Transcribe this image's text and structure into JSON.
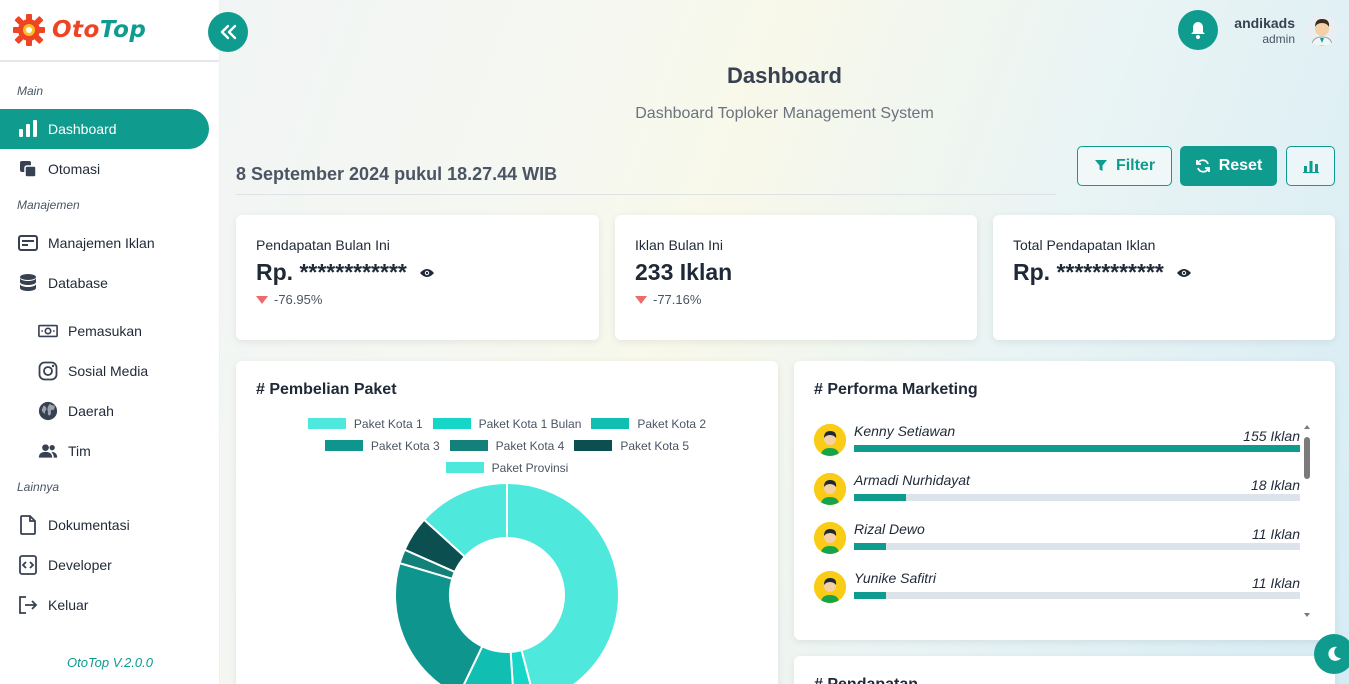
{
  "app": {
    "logo_text_a": "Oto",
    "logo_text_b": "Top",
    "version": "OtoTop V.2.0.0"
  },
  "sidebar": {
    "sections": {
      "main": "Main",
      "manajemen": "Manajemen",
      "lainnya": "Lainnya"
    },
    "items": {
      "dashboard": "Dashboard",
      "otomasi": "Otomasi",
      "manajemen_iklan": "Manajemen Iklan",
      "database": "Database",
      "pemasukan": "Pemasukan",
      "sosial_media": "Sosial Media",
      "daerah": "Daerah",
      "tim": "Tim",
      "dokumentasi": "Dokumentasi",
      "developer": "Developer",
      "keluar": "Keluar"
    }
  },
  "user": {
    "name": "andikads",
    "role": "admin"
  },
  "header": {
    "title": "Dashboard",
    "subtitle": "Dashboard Toploker Management System",
    "datetime": "8 September 2024 pukul 18.27.44 WIB"
  },
  "actions": {
    "filter": "Filter",
    "reset": "Reset"
  },
  "stats": [
    {
      "label": "Pendapatan Bulan Ini",
      "value": "Rp. ************",
      "change": "-76.95%"
    },
    {
      "label": "Iklan Bulan Ini",
      "value": "233 Iklan",
      "change": "-77.16%"
    },
    {
      "label": "Total Pendapatan Iklan",
      "value": "Rp. ************"
    }
  ],
  "pembelian": {
    "title": "# Pembelian Paket"
  },
  "chart_data": {
    "type": "pie",
    "labels": [
      "Paket Kota 1",
      "Paket Kota 1 Bulan",
      "Paket Kota 2",
      "Paket Kota 3",
      "Paket Kota 4",
      "Paket Kota 5",
      "Paket Provinsi"
    ],
    "values": [
      45,
      3,
      8,
      22,
      2,
      5,
      13
    ],
    "colors": [
      "#4ee8dc",
      "#16d6c8",
      "#10bfb2",
      "#0e968e",
      "#138079",
      "#0b4f50",
      "#4ee8dc"
    ]
  },
  "performa": {
    "title": "# Performa Marketing",
    "items": [
      {
        "name": "Kenny Setiawan",
        "count": "155 Iklan",
        "value": 155
      },
      {
        "name": "Armadi Nurhidayat",
        "count": "18 Iklan",
        "value": 18
      },
      {
        "name": "Rizal Dewo",
        "count": "11 Iklan",
        "value": 11
      },
      {
        "name": "Yunike Safitri",
        "count": "11 Iklan",
        "value": 11
      }
    ],
    "max": 155
  },
  "pendapatan": {
    "title": "# Pendapatan"
  }
}
